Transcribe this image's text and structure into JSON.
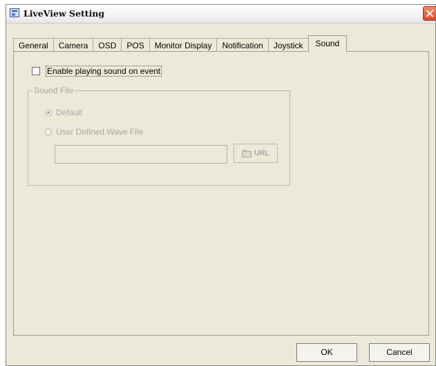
{
  "window": {
    "title": "LiveView Setting"
  },
  "tabs": [
    {
      "label": "General"
    },
    {
      "label": "Camera"
    },
    {
      "label": "OSD"
    },
    {
      "label": "POS"
    },
    {
      "label": "Monitor Display"
    },
    {
      "label": "Notification"
    },
    {
      "label": "Joystick"
    },
    {
      "label": "Sound",
      "active": true
    }
  ],
  "sound": {
    "enable_label": "Enable playing sound on event",
    "enable_checked": false,
    "group_label": "Sound File",
    "default_label": "Default",
    "default_selected": true,
    "user_label": "User Defined Wave File",
    "file_value": "",
    "url_label": "URL"
  },
  "footer": {
    "ok_label": "OK",
    "cancel_label": "Cancel"
  },
  "colors": {
    "dialog_bg": "#ece9d8",
    "disabled_text": "#a8a8a8",
    "close_red": "#d84a2a"
  }
}
